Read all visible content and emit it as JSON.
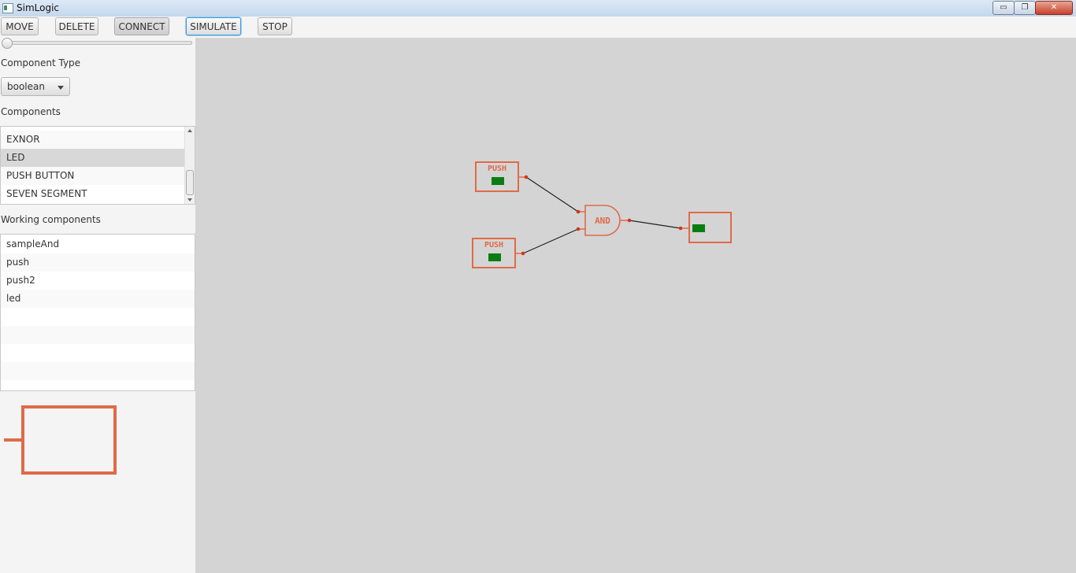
{
  "window": {
    "title": "SimLogic",
    "min_glyph": "▭",
    "max_glyph": "❐",
    "close_glyph": "✕"
  },
  "toolbar": {
    "move": "MOVE",
    "delete": "DELETE",
    "connect": "CONNECT",
    "simulate": "SIMULATE",
    "stop": "STOP"
  },
  "sidebar": {
    "component_type_label": "Component Type",
    "component_type_value": "boolean",
    "components_label": "Components",
    "components": [
      "EXNOR",
      "LED",
      "PUSH BUTTON",
      "SEVEN SEGMENT"
    ],
    "selected_component": "LED",
    "working_label": "Working components",
    "working": [
      "sampleAnd",
      "push",
      "push2",
      "led"
    ]
  },
  "circuit": {
    "push1_label": "PUSH",
    "push2_label": "PUSH",
    "and_label": "AND",
    "colors": {
      "outline": "#e06a48",
      "indicator": "#0a7d12",
      "pin": "#d1371a",
      "wire": "#222222"
    }
  }
}
